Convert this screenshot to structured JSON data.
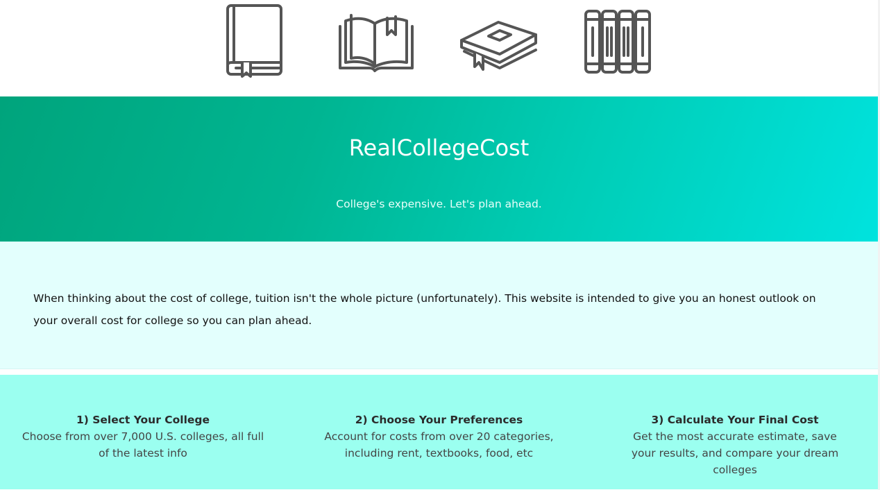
{
  "icons": [
    "closed-book-icon",
    "open-book-icon",
    "graduation-book-icon",
    "books-on-shelf-icon"
  ],
  "hero": {
    "title": "RealCollegeCost",
    "tagline": "College's expensive. Let's plan ahead.",
    "gradient_colors": [
      "#00a47c",
      "#00e3de"
    ]
  },
  "intro": {
    "text": "When thinking about the cost of college, tuition isn't the whole picture (unfortunately). This website is intended to give you an honest outlook on your overall cost for college so you can plan ahead."
  },
  "steps": [
    {
      "title": "1) Select Your College",
      "description": "Choose from over 7,000 U.S. colleges, all full of the latest info"
    },
    {
      "title": "2) Choose Your Preferences",
      "description": "Account for costs from over 20 categories, including rent, textbooks, food, etc"
    },
    {
      "title": "3) Calculate Your Final Cost",
      "description": "Get the most accurate estimate, save your results, and compare your dream colleges"
    }
  ],
  "colors": {
    "icon_stroke": "#555555",
    "intro_bg": "#e3fffd",
    "steps_bg": "#9bfff0"
  }
}
